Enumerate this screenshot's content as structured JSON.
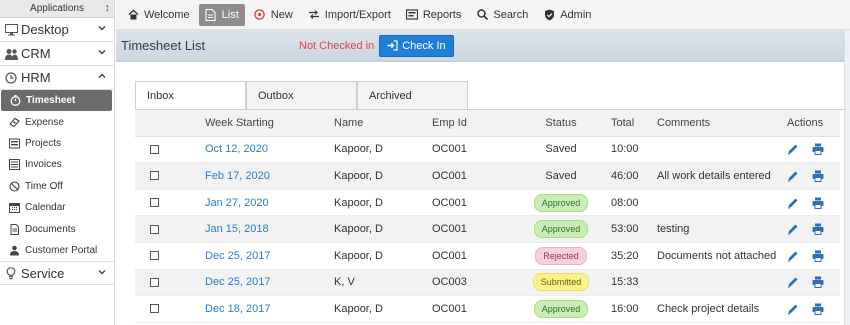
{
  "sidebar": {
    "applications_label": "Applications",
    "sections": {
      "desktop": "Desktop",
      "crm": "CRM",
      "hrm": "HRM",
      "service": "Service"
    },
    "hrm_items": [
      {
        "label": "Timesheet",
        "icon": "stopwatch-icon",
        "active": true
      },
      {
        "label": "Expense",
        "icon": "money-icon"
      },
      {
        "label": "Projects",
        "icon": "projects-icon"
      },
      {
        "label": "Invoices",
        "icon": "invoice-icon"
      },
      {
        "label": "Time Off",
        "icon": "time-off-icon"
      },
      {
        "label": "Calendar",
        "icon": "calendar-icon"
      },
      {
        "label": "Documents",
        "icon": "document-icon"
      },
      {
        "label": "Customer Portal",
        "icon": "portal-icon"
      }
    ]
  },
  "toolbar": {
    "welcome": "Welcome",
    "list": "List",
    "new": "New",
    "import_export": "Import/Export",
    "reports": "Reports",
    "search": "Search",
    "admin": "Admin"
  },
  "header": {
    "title": "Timesheet List",
    "status_text": "Not Checked in",
    "checkin_label": "Check In"
  },
  "tabs": [
    "Inbox",
    "Outbox",
    "Archived"
  ],
  "columns": {
    "week": "Week Starting",
    "name": "Name",
    "emp": "Emp Id",
    "status": "Status",
    "total": "Total",
    "comments": "Comments",
    "actions": "Actions"
  },
  "rows": [
    {
      "week": "Oct 12, 2020",
      "name": "Kapoor, D",
      "emp": "OC001",
      "status": "Saved",
      "total": "10:00",
      "comments": ""
    },
    {
      "week": "Feb 17, 2020",
      "name": "Kapoor, D",
      "emp": "OC001",
      "status": "Saved",
      "total": "46:00",
      "comments": "All work details entered"
    },
    {
      "week": "Jan 27, 2020",
      "name": "Kapoor, D",
      "emp": "OC001",
      "status": "Approved",
      "total": "08:00",
      "comments": ""
    },
    {
      "week": "Jan 15, 2018",
      "name": "Kapoor, D",
      "emp": "OC001",
      "status": "Approved",
      "total": "53:00",
      "comments": "testing"
    },
    {
      "week": "Dec 25, 2017",
      "name": "Kapoor, D",
      "emp": "OC001",
      "status": "Rejected",
      "total": "35:20",
      "comments": "Documents not attached"
    },
    {
      "week": "Dec 25, 2017",
      "name": "K, V",
      "emp": "OC003",
      "status": "Submitted",
      "total": "15:33",
      "comments": ""
    },
    {
      "week": "Dec 18, 2017",
      "name": "Kapoor, D",
      "emp": "OC001",
      "status": "Approved",
      "total": "16:00",
      "comments": "Check project details"
    }
  ],
  "colors": {
    "accent": "#1f7fd6",
    "link": "#2f7bc8",
    "alert": "#e2424b",
    "approved": "#c7eeb4",
    "rejected": "#f6d2dc",
    "submitted": "#faf38a"
  }
}
